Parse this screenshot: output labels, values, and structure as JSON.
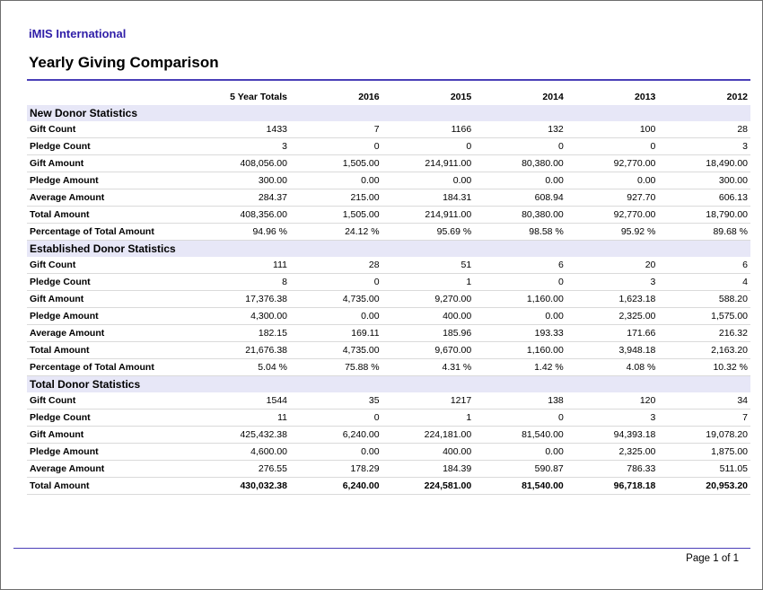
{
  "header": {
    "org_name": "iMIS International",
    "title": "Yearly Giving Comparison"
  },
  "table": {
    "columns": [
      "5 Year Totals",
      "2016",
      "2015",
      "2014",
      "2013",
      "2012"
    ],
    "sections": [
      {
        "title": "New Donor Statistics",
        "rows": [
          {
            "label": "Gift Count",
            "values": [
              "1433",
              "7",
              "1166",
              "132",
              "100",
              "28"
            ]
          },
          {
            "label": "Pledge Count",
            "values": [
              "3",
              "0",
              "0",
              "0",
              "0",
              "3"
            ]
          },
          {
            "label": "Gift Amount",
            "values": [
              "408,056.00",
              "1,505.00",
              "214,911.00",
              "80,380.00",
              "92,770.00",
              "18,490.00"
            ]
          },
          {
            "label": "Pledge Amount",
            "values": [
              "300.00",
              "0.00",
              "0.00",
              "0.00",
              "0.00",
              "300.00"
            ]
          },
          {
            "label": "Average Amount",
            "values": [
              "284.37",
              "215.00",
              "184.31",
              "608.94",
              "927.70",
              "606.13"
            ]
          },
          {
            "label": "Total Amount",
            "values": [
              "408,356.00",
              "1,505.00",
              "214,911.00",
              "80,380.00",
              "92,770.00",
              "18,790.00"
            ]
          },
          {
            "label": "Percentage of Total Amount",
            "values": [
              "94.96 %",
              "24.12 %",
              "95.69 %",
              "98.58 %",
              "95.92 %",
              "89.68 %"
            ]
          }
        ]
      },
      {
        "title": "Established Donor Statistics",
        "rows": [
          {
            "label": "Gift Count",
            "values": [
              "111",
              "28",
              "51",
              "6",
              "20",
              "6"
            ]
          },
          {
            "label": "Pledge Count",
            "values": [
              "8",
              "0",
              "1",
              "0",
              "3",
              "4"
            ]
          },
          {
            "label": "Gift Amount",
            "values": [
              "17,376.38",
              "4,735.00",
              "9,270.00",
              "1,160.00",
              "1,623.18",
              "588.20"
            ]
          },
          {
            "label": "Pledge Amount",
            "values": [
              "4,300.00",
              "0.00",
              "400.00",
              "0.00",
              "2,325.00",
              "1,575.00"
            ]
          },
          {
            "label": "Average Amount",
            "values": [
              "182.15",
              "169.11",
              "185.96",
              "193.33",
              "171.66",
              "216.32"
            ]
          },
          {
            "label": "Total Amount",
            "values": [
              "21,676.38",
              "4,735.00",
              "9,670.00",
              "1,160.00",
              "3,948.18",
              "2,163.20"
            ]
          },
          {
            "label": "Percentage of Total Amount",
            "values": [
              "5.04 %",
              "75.88 %",
              "4.31 %",
              "1.42 %",
              "4.08 %",
              "10.32 %"
            ]
          }
        ]
      },
      {
        "title": "Total Donor Statistics",
        "rows": [
          {
            "label": "Gift Count",
            "values": [
              "1544",
              "35",
              "1217",
              "138",
              "120",
              "34"
            ]
          },
          {
            "label": "Pledge Count",
            "values": [
              "11",
              "0",
              "1",
              "0",
              "3",
              "7"
            ]
          },
          {
            "label": "Gift Amount",
            "values": [
              "425,432.38",
              "6,240.00",
              "224,181.00",
              "81,540.00",
              "94,393.18",
              "19,078.20"
            ]
          },
          {
            "label": "Pledge Amount",
            "values": [
              "4,600.00",
              "0.00",
              "400.00",
              "0.00",
              "2,325.00",
              "1,875.00"
            ]
          },
          {
            "label": "Average Amount",
            "values": [
              "276.55",
              "178.29",
              "184.39",
              "590.87",
              "786.33",
              "511.05"
            ]
          },
          {
            "label": "Total Amount",
            "values": [
              "430,032.38",
              "6,240.00",
              "224,581.00",
              "81,540.00",
              "96,718.18",
              "20,953.20"
            ],
            "bold": true
          }
        ]
      }
    ]
  },
  "footer": {
    "page_label": "Page 1 of  1"
  },
  "colors": {
    "accent": "#2f1ea8",
    "rule": "#4a3fb8",
    "section_band": "#e7e7f7"
  }
}
